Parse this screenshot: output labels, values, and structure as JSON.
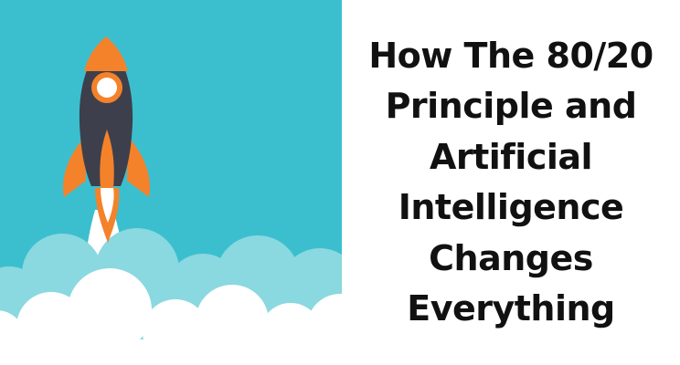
{
  "colors": {
    "sky": "#3bbfcf",
    "cloud_back": "#8ad8e0",
    "cloud_front": "#ffffff",
    "rocket_body": "#3d3f4c",
    "rocket_accent": "#f4822a",
    "window_ring": "#f4822a",
    "window_glass": "#ffffff",
    "title_text": "#111111"
  },
  "icons": {
    "illustration": "rocket-launch-icon"
  },
  "title": {
    "lines": [
      "How The 80/20",
      "Principle and",
      "Artificial",
      "Intelligence",
      "Changes",
      "Everything"
    ]
  }
}
